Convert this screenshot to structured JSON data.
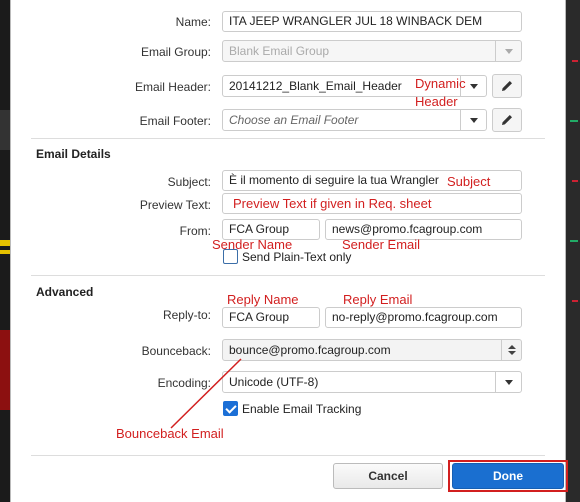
{
  "fields": {
    "name": {
      "label": "Name:",
      "value": "ITA JEEP WRANGLER JUL 18 WINBACK DEM"
    },
    "email_group": {
      "label": "Email Group:",
      "value": "Blank Email Group"
    },
    "email_header": {
      "label": "Email Header:",
      "value": "20141212_Blank_Email_Header"
    },
    "email_footer": {
      "label": "Email Footer:",
      "placeholder": "Choose an Email Footer"
    }
  },
  "email_details": {
    "title": "Email Details",
    "subject": {
      "label": "Subject:",
      "value": "È il momento di seguire la tua Wrangler"
    },
    "preview_text": {
      "label": "Preview Text:",
      "value": ""
    },
    "from": {
      "label": "From:",
      "sender_name": "FCA Group",
      "sender_email": "news@promo.fcagroup.com"
    },
    "plain_text_label": "Send Plain-Text only",
    "plain_text_checked": false
  },
  "advanced": {
    "title": "Advanced",
    "reply_to": {
      "label": "Reply-to:",
      "name": "FCA Group",
      "email": "no-reply@promo.fcagroup.com"
    },
    "bounceback": {
      "label": "Bounceback:",
      "value": "bounce@promo.fcagroup.com"
    },
    "encoding": {
      "label": "Encoding:",
      "value": "Unicode (UTF-8)"
    },
    "tracking_label": "Enable Email Tracking",
    "tracking_checked": true
  },
  "annotations": {
    "dynamic": "Dynamic",
    "header": "Header",
    "subject": "Subject",
    "preview": "Preview Text if given in Req. sheet",
    "sender_name": "Sender Name",
    "sender_email": "Sender Email",
    "reply_name": "Reply Name",
    "reply_email": "Reply Email",
    "bounceback": "Bounceback Email"
  },
  "buttons": {
    "cancel": "Cancel",
    "done": "Done"
  },
  "icons": {
    "edit": "pencil-icon"
  },
  "colors": {
    "annotation": "#d21f1f",
    "primary": "#1a6fd0"
  }
}
